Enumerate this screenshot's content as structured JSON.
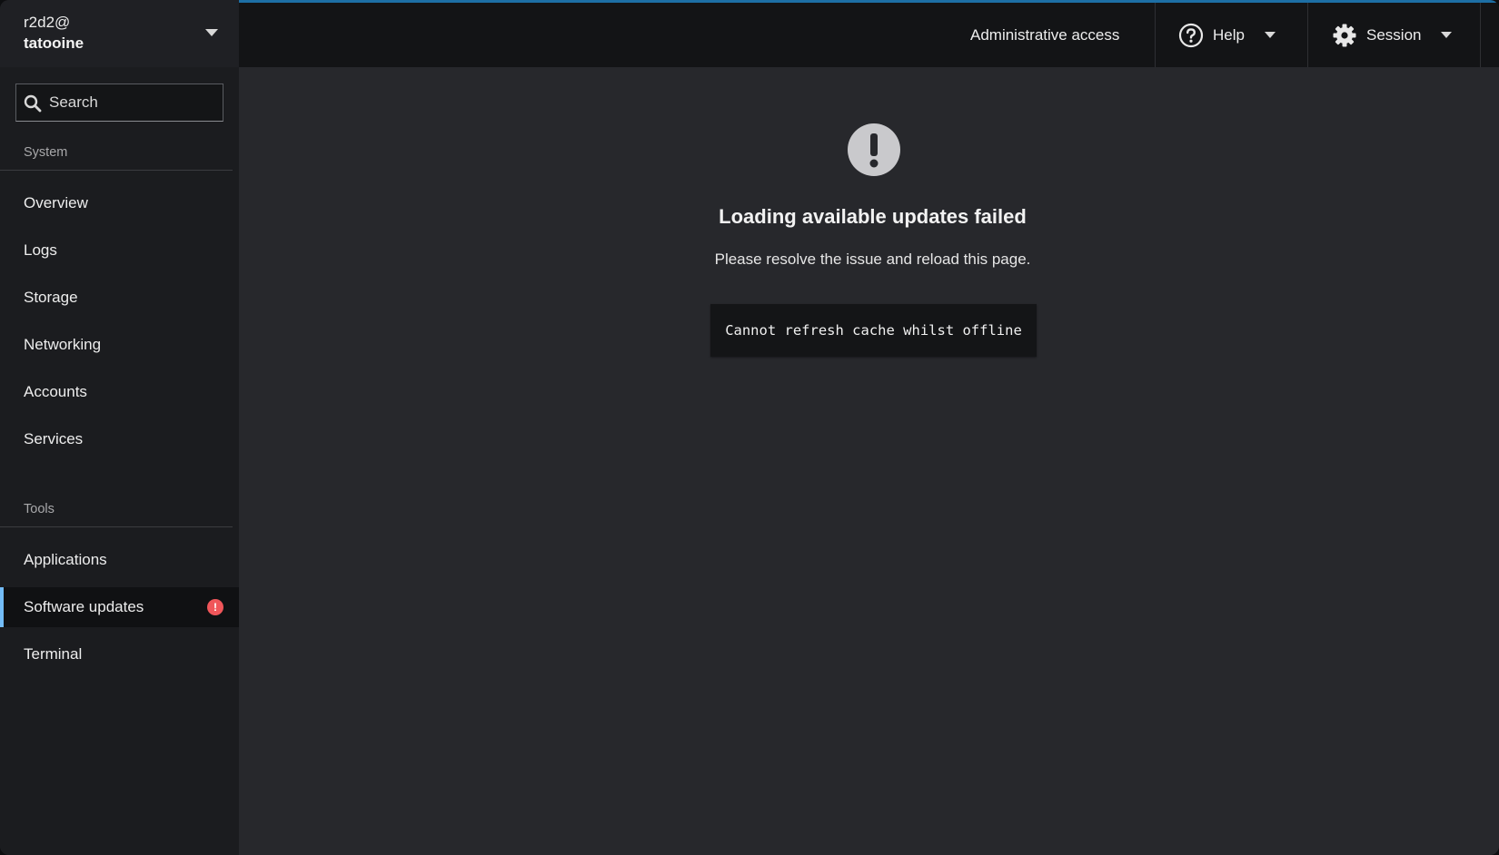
{
  "host": {
    "user": "r2d2@",
    "machine": "tatooine"
  },
  "search": {
    "placeholder": "Search"
  },
  "sidebar": {
    "sections": [
      {
        "title": "System",
        "items": [
          {
            "label": "Overview"
          },
          {
            "label": "Logs"
          },
          {
            "label": "Storage"
          },
          {
            "label": "Networking"
          },
          {
            "label": "Accounts"
          },
          {
            "label": "Services"
          }
        ]
      },
      {
        "title": "Tools",
        "items": [
          {
            "label": "Applications"
          },
          {
            "label": "Software updates",
            "active": true,
            "badge": "!"
          },
          {
            "label": "Terminal"
          }
        ]
      }
    ]
  },
  "topbar": {
    "admin_access": "Administrative access",
    "help": "Help",
    "session": "Session",
    "accent_color": "#1d6fa5"
  },
  "main": {
    "empty_state": {
      "icon": "exclamation-circle-icon",
      "title": "Loading available updates failed",
      "body": "Please resolve the issue and reload this page.",
      "error_code": "Cannot refresh cache whilst offline"
    }
  },
  "colors": {
    "active_indicator": "#73bcf7",
    "badge_danger": "#f0565a"
  }
}
